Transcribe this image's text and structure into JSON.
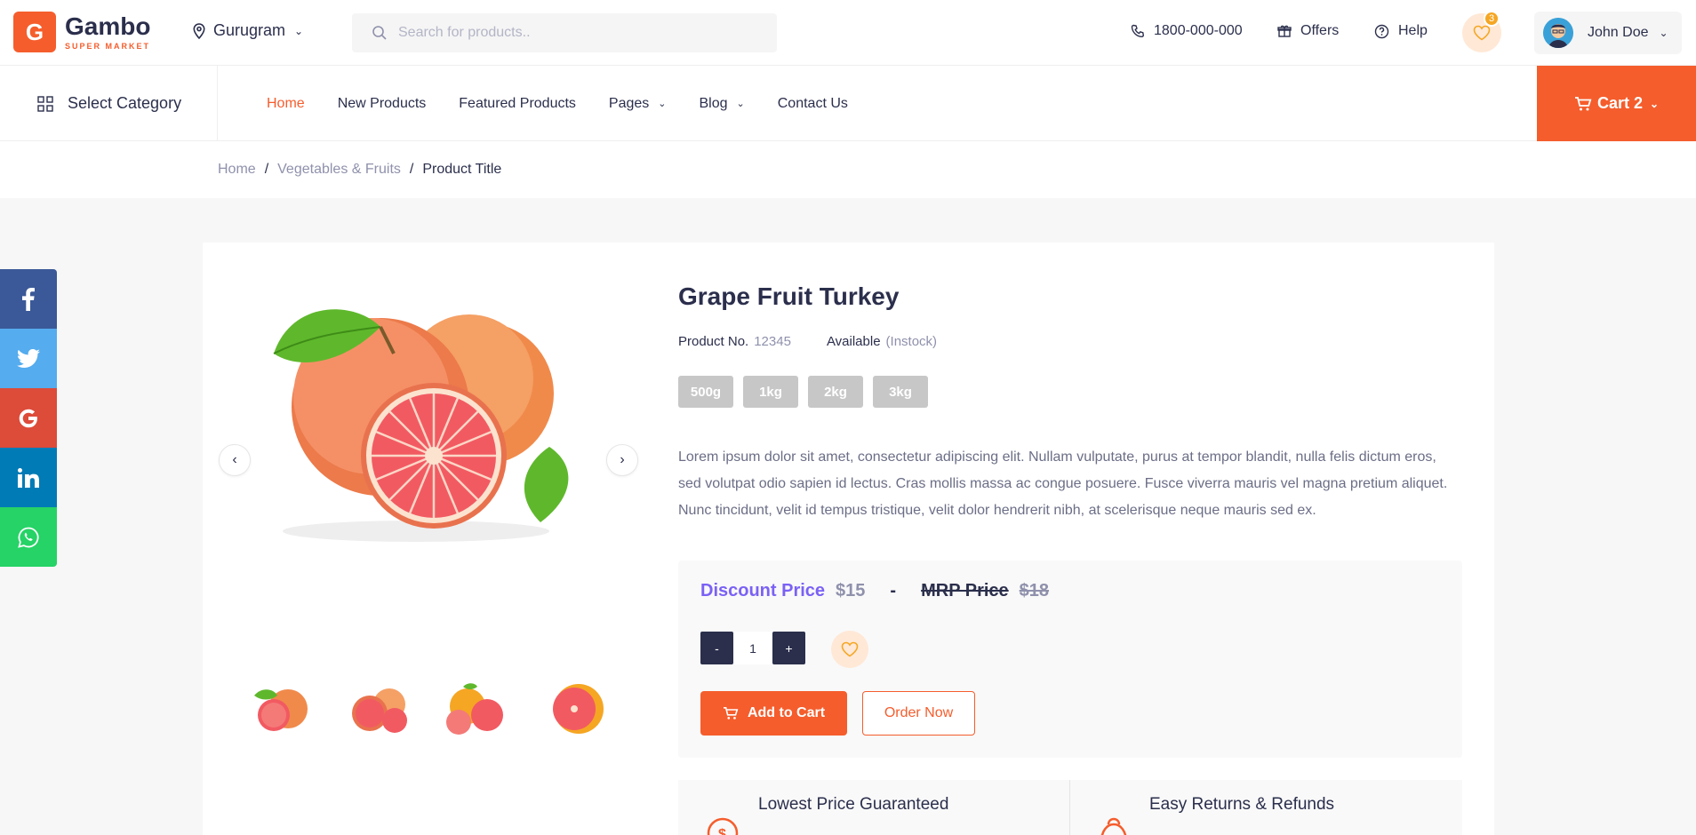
{
  "brand": {
    "name": "Gambo",
    "tagline": "SUPER MARKET",
    "letter": "G",
    "color": "#f55d2c"
  },
  "location": {
    "city": "Gurugram"
  },
  "search": {
    "placeholder": "Search for products.."
  },
  "header": {
    "phone": "1800-000-000",
    "offers": "Offers",
    "help": "Help",
    "wishlist_count": "3",
    "user_name": "John Doe"
  },
  "nav": {
    "select_category": "Select Category",
    "items": [
      {
        "label": "Home",
        "active": true
      },
      {
        "label": "New Products"
      },
      {
        "label": "Featured Products"
      },
      {
        "label": "Pages",
        "dropdown": true
      },
      {
        "label": "Blog",
        "dropdown": true
      },
      {
        "label": "Contact Us"
      }
    ],
    "cart_label": "Cart 2"
  },
  "breadcrumb": {
    "items": [
      "Home",
      "Vegetables & Fruits",
      "Product Title"
    ]
  },
  "product": {
    "title": "Grape Fruit Turkey",
    "product_no_label": "Product No.",
    "product_no": "12345",
    "availability_label": "Available",
    "availability": "(Instock)",
    "sizes": [
      "500g",
      "1kg",
      "2kg",
      "3kg"
    ],
    "description": "Lorem ipsum dolor sit amet, consectetur adipiscing elit. Nullam vulputate, purus at tempor blandit, nulla felis dictum eros, sed volutpat odio sapien id lectus. Cras mollis massa ac congue posuere. Fusce viverra mauris vel magna pretium aliquet. Nunc tincidunt, velit id tempus tristique, velit dolor hendrerit nibh, at scelerisque neque mauris sed ex.",
    "discount_label": "Discount Price",
    "discount_price": "$15",
    "separator": "-",
    "mrp_label": "MRP Price",
    "mrp_price": "$18",
    "qty_minus": "-",
    "qty_value": "1",
    "qty_plus": "+",
    "add_to_cart": "Add to Cart",
    "order_now": "Order Now"
  },
  "features": [
    {
      "title": "Lowest Price Guaranteed"
    },
    {
      "title": "Easy Returns & Refunds"
    }
  ],
  "social": [
    {
      "name": "facebook",
      "glyph": "f",
      "color": "#3b5998"
    },
    {
      "name": "twitter",
      "glyph": "t",
      "color": "#55acee"
    },
    {
      "name": "google",
      "glyph": "G",
      "color": "#dd4b39"
    },
    {
      "name": "linkedin",
      "glyph": "in",
      "color": "#007bb5"
    },
    {
      "name": "whatsapp",
      "glyph": "w",
      "color": "#25d366"
    }
  ],
  "colors": {
    "accent": "#f55d2c",
    "dark": "#2b2f4c",
    "purple": "#7b61f5",
    "muted": "#8f91ac"
  }
}
